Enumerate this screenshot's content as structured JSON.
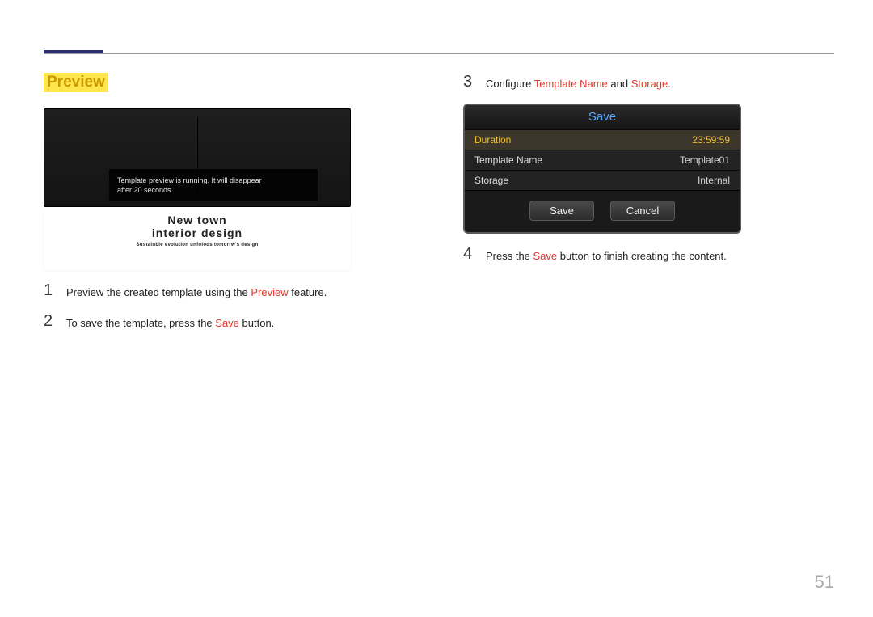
{
  "page_number": "51",
  "left": {
    "heading": "Preview",
    "preview_popup_line1": "Template preview is running. It will disappear",
    "preview_popup_line2": "after 20 seconds.",
    "preview_caption_line1": "New  town",
    "preview_caption_line2": "interior  design",
    "preview_caption_sub": "Sustainble evolution unfolods tomorrw's design",
    "step1": {
      "num": "1",
      "pre": "Preview the created template using the ",
      "hl": "Preview",
      "post": " feature."
    },
    "step2": {
      "num": "2",
      "pre": "To save the template, press the ",
      "hl": "Save",
      "post": " button."
    }
  },
  "right": {
    "step3": {
      "num": "3",
      "pre": "Configure ",
      "hl1": "Template Name",
      "mid": " and ",
      "hl2": "Storage",
      "post": "."
    },
    "save_box": {
      "title": "Save",
      "rows": [
        {
          "label": "Duration",
          "value": "23:59:59",
          "selected": true
        },
        {
          "label": "Template Name",
          "value": "Template01",
          "selected": false
        },
        {
          "label": "Storage",
          "value": "Internal",
          "selected": false
        }
      ],
      "save_btn": "Save",
      "cancel_btn": "Cancel"
    },
    "step4": {
      "num": "4",
      "pre": "Press the ",
      "hl": "Save",
      "post": " button to finish creating the content."
    }
  }
}
